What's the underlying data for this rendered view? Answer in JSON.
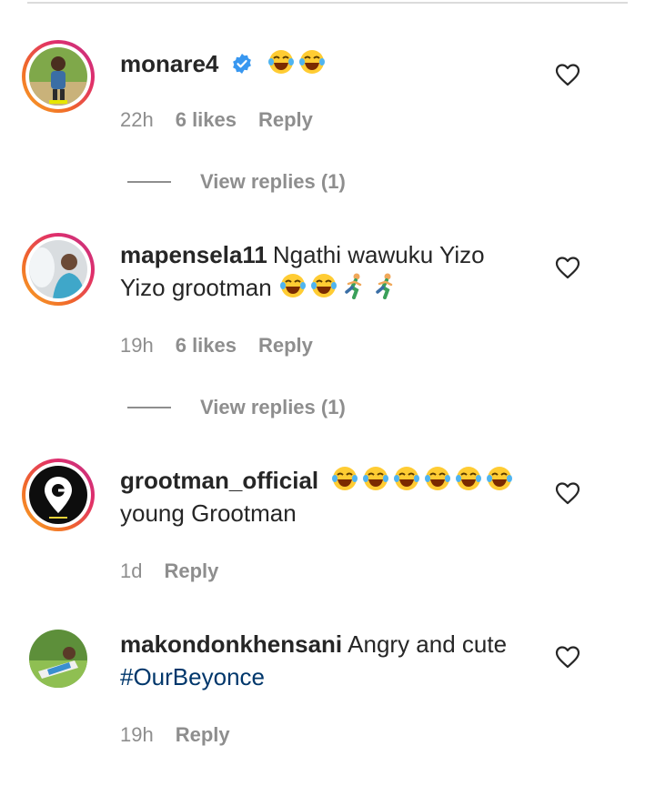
{
  "comments": [
    {
      "username": "monare4",
      "verified": true,
      "text": "",
      "text2": "",
      "emoji_count": 2,
      "time": "22h",
      "likes": "6 likes",
      "reply": "Reply",
      "view_replies": "View replies (1)"
    },
    {
      "username": "mapensela11",
      "text": "Ngathi wawuku Yizo",
      "text2": "Yizo grootman",
      "time": "19h",
      "likes": "6 likes",
      "reply": "Reply",
      "view_replies": "View replies (1)"
    },
    {
      "username": "grootman_official",
      "text": "young Grootman",
      "emoji_count": 6,
      "time": "1d",
      "reply": "Reply"
    },
    {
      "username": "makondonkhensani",
      "text": "Angry and cute",
      "hashtag": "#OurBeyonce",
      "time": "19h",
      "reply": "Reply"
    }
  ],
  "colors": {
    "text": "#262626",
    "muted": "#8e8e8e",
    "hashtag": "#00376b",
    "verified": "#3897f0"
  },
  "icons": [
    "heart-outline-icon",
    "verified-badge-icon",
    "laughing-emoji-icon",
    "running-emoji-icon"
  ]
}
